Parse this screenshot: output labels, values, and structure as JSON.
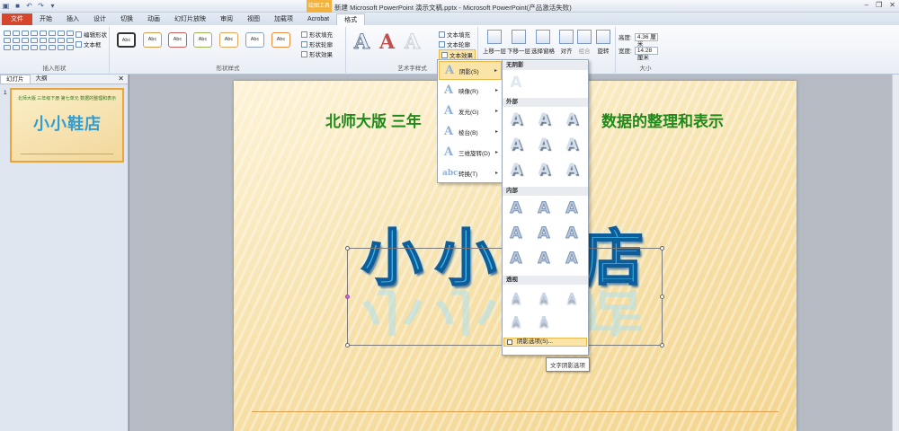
{
  "window": {
    "title": "新建 Microsoft PowerPoint 演示文稿.pptx - Microsoft PowerPoint(产品激活失败)",
    "context_tab_title": "绘图工具",
    "minimize": "–",
    "restore": "❐",
    "close": "✕"
  },
  "tabs": [
    "文件",
    "开始",
    "插入",
    "设计",
    "切换",
    "动画",
    "幻灯片放映",
    "审阅",
    "视图",
    "加载项",
    "Acrobat",
    "格式"
  ],
  "active_tab_index": 11,
  "ribbon": {
    "insert_shapes": {
      "label": "插入形状",
      "edit_shape": "编辑形状",
      "text_box": "文本框"
    },
    "shape_styles": {
      "label": "形状样式",
      "swatch_text": "Abc",
      "fill": "形状填充",
      "outline": "形状轮廓",
      "effects": "形状效果"
    },
    "wordart_styles": {
      "label": "艺术字样式",
      "glyph": "A",
      "text_fill": "文本填充",
      "text_outline": "文本轮廓",
      "text_effects": "文本效果"
    },
    "arrange": {
      "bring_forward": "上移一层",
      "send_backward": "下移一层",
      "selection_pane": "选择窗格",
      "align": "对齐",
      "group": "组合",
      "rotate": "旋转"
    },
    "size": {
      "label": "大小",
      "height_label": "高度:",
      "height_value": "4.36 厘米",
      "width_label": "宽度:",
      "width_value": "14.28 厘米"
    }
  },
  "left_pane": {
    "tabs": [
      "幻灯片",
      "大纲"
    ],
    "close": "✕",
    "slide_number": "1",
    "thumb_title": "北师大版 三年级下册 第七单元 数据的整理和表示",
    "thumb_text": "小小鞋店"
  },
  "slide": {
    "title_left": "北师大版  三年",
    "title_right": "数据的整理和表示",
    "wordart_text": "小小鞋店"
  },
  "text_effects_menu": {
    "items": [
      {
        "label": "阴影(S)",
        "icon": "shadow-icon"
      },
      {
        "label": "映像(R)",
        "icon": "reflection-icon"
      },
      {
        "label": "发光(G)",
        "icon": "glow-icon"
      },
      {
        "label": "棱台(B)",
        "icon": "bevel-icon"
      },
      {
        "label": "三维旋转(D)",
        "icon": "3d-rotation-icon"
      },
      {
        "label": "转换(T)",
        "icon": "transform-icon"
      }
    ],
    "highlighted_index": 0
  },
  "shadow_gallery": {
    "sections": {
      "none": "无阴影",
      "outer": "外部",
      "inner": "内部",
      "perspective": "透视"
    },
    "glyph": "A",
    "options_label": "阴影选项(S)...",
    "tooltip": "文字阴影选项"
  }
}
